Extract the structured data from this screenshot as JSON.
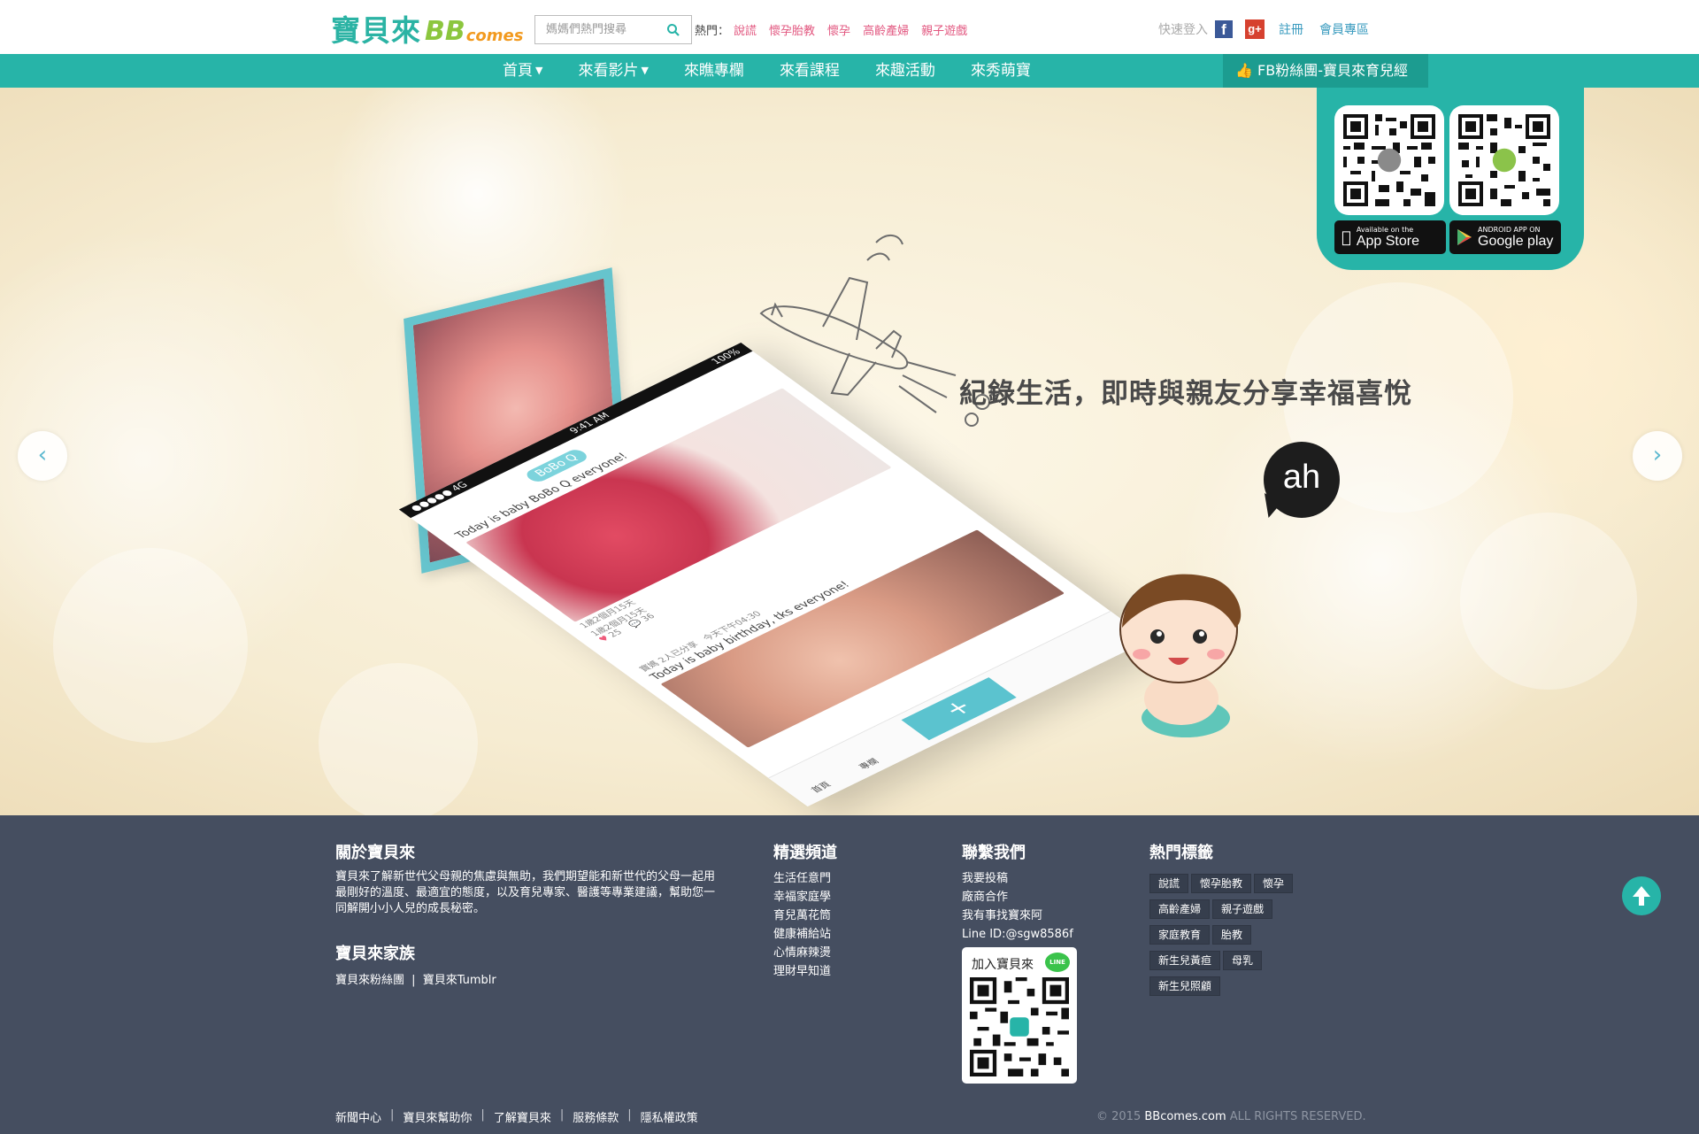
{
  "header": {
    "logo_cn": "寶貝來",
    "logo_bb": "BB",
    "logo_comes": "comes",
    "search_placeholder": "媽媽們熱門搜尋",
    "hot_label": "熱門：",
    "hot_links": [
      "說謊",
      "懷孕胎教",
      "懷孕",
      "高齡產婦",
      "親子遊戲"
    ],
    "login_label": "快速登入",
    "fb_icon": "f",
    "gplus_icon": "g+",
    "register": "註冊",
    "member_area": "會員專區"
  },
  "nav": {
    "items": [
      {
        "label": "首頁",
        "dropdown": true
      },
      {
        "label": "來看影片",
        "dropdown": true
      },
      {
        "label": "來瞧專欄",
        "dropdown": false
      },
      {
        "label": "來看課程",
        "dropdown": false
      },
      {
        "label": "來趣活動",
        "dropdown": false
      },
      {
        "label": "來秀萌寶",
        "dropdown": false
      }
    ],
    "fb_fans": "FB粉絲團-寶貝來育兒經"
  },
  "hero": {
    "slogan": "紀錄生活，即時與親友分享幸福喜悅",
    "speech_bubble": "ah",
    "prev": "‹",
    "next": "›",
    "app_store": {
      "small": "Available on the",
      "big": "App Store"
    },
    "google_play": {
      "small": "ANDROID APP ON",
      "big": "Google play"
    },
    "phone": {
      "status_left": "●●●●● 4G",
      "time": "9:41 AM",
      "battery": "100%",
      "tag": "BoBo Q",
      "post1_text": "Today is baby BoBo Q everyone!",
      "post1_meta": [
        "1歲2個月15天",
        "1歲2個月15天"
      ],
      "post1_likes": "25",
      "post1_comments": "36",
      "post2_author": "寶媽",
      "post2_meta": "2人已分享　今天下午04:30",
      "post2_text": "Today is baby birthday, tks everyone!",
      "plus": "+",
      "tab_home": "首頁",
      "tab_column": "專欄"
    }
  },
  "footer": {
    "about_title": "關於寶貝來",
    "about_text": "寶貝來了解新世代父母親的焦慮與無助，我們期望能和新世代的父母一起用最剛好的溫度、最適宜的態度，以及育兒專家、醫護等專業建議，幫助您一同解開小小人兒的成長秘密。",
    "family_title": "寶貝來家族",
    "family_links": [
      "寶貝來粉絲團",
      "|",
      "寶貝來Tumblr"
    ],
    "channels_title": "精選頻道",
    "channels": [
      "生活任意門",
      "幸福家庭學",
      "育兒萬花筒",
      "健康補給站",
      "心情麻辣燙",
      "理財早知道"
    ],
    "contact_title": "聯繫我們",
    "contact": [
      "我要投稿",
      "廠商合作",
      "我有事找寶來阿",
      "Line ID:@sgw8586f"
    ],
    "line_card_title": "加入寶貝來",
    "line_badge": "LINE",
    "tags_title": "熱門標籤",
    "tags": [
      "說謊",
      "懷孕胎教",
      "懷孕",
      "高齡產婦",
      "親子遊戲",
      "家庭教育",
      "胎教",
      "新生兒黃疸",
      "母乳",
      "新生兒照顧"
    ],
    "bottom_links": [
      "新聞中心",
      "寶貝來幫助你",
      "了解寶貝來",
      "服務條款",
      "隱私權政策"
    ],
    "copyright_prefix": "© 2015",
    "copyright_brand": "BBcomes.com",
    "copyright_suffix": "ALL RIGHTS RESERVED."
  },
  "colors": {
    "teal": "#27b4a8",
    "footer_bg": "#454e60",
    "hot_pink": "#e2567f",
    "link_blue": "#3a9bbf"
  }
}
